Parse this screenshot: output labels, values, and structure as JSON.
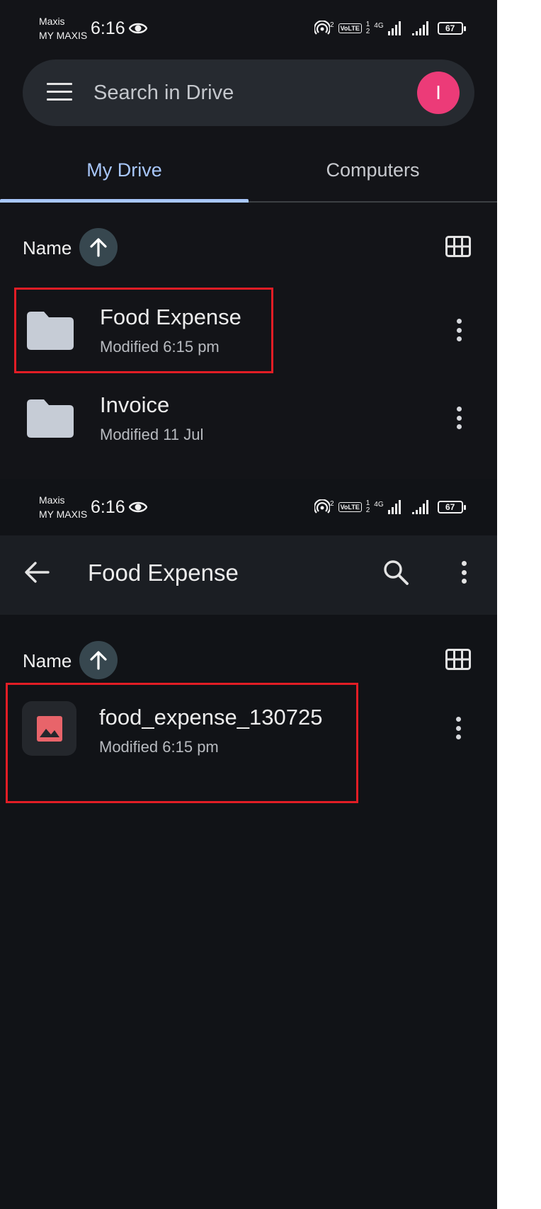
{
  "screen1": {
    "status": {
      "carrier_line1": "Maxis",
      "carrier_line2": "MY MAXIS",
      "time": "6:16",
      "network_sup": "2",
      "volte": "VoLTE",
      "sim1": "1",
      "sim2": "2",
      "net_type": "4G",
      "battery": "67"
    },
    "search": {
      "placeholder": "Search in Drive",
      "avatar_letter": "I"
    },
    "tabs": [
      {
        "label": "My Drive",
        "selected": true
      },
      {
        "label": "Computers",
        "selected": false
      }
    ],
    "sort": {
      "label": "Name",
      "direction": "ascending"
    },
    "items": [
      {
        "name": "Food Expense",
        "modified": "Modified 6:15 pm",
        "type": "folder",
        "highlighted": true
      },
      {
        "name": "Invoice",
        "modified": "Modified 11 Jul",
        "type": "folder",
        "highlighted": false
      }
    ]
  },
  "screen2": {
    "status": {
      "carrier_line1": "Maxis",
      "carrier_line2": "MY MAXIS",
      "time": "6:16",
      "network_sup": "2",
      "volte": "VoLTE",
      "sim1": "1",
      "sim2": "2",
      "net_type": "4G",
      "battery": "67"
    },
    "title": "Food Expense",
    "sort": {
      "label": "Name",
      "direction": "ascending"
    },
    "items": [
      {
        "name": "food_expense_130725",
        "modified": "Modified 6:15 pm",
        "type": "image",
        "highlighted": true
      }
    ]
  },
  "colors": {
    "accent": "#a8c7fa",
    "avatar": "#ec3b78",
    "highlight_box": "#e21d25",
    "folder_icon": "#c6ccd6",
    "image_icon": "#e8646a",
    "background": "#131418"
  }
}
